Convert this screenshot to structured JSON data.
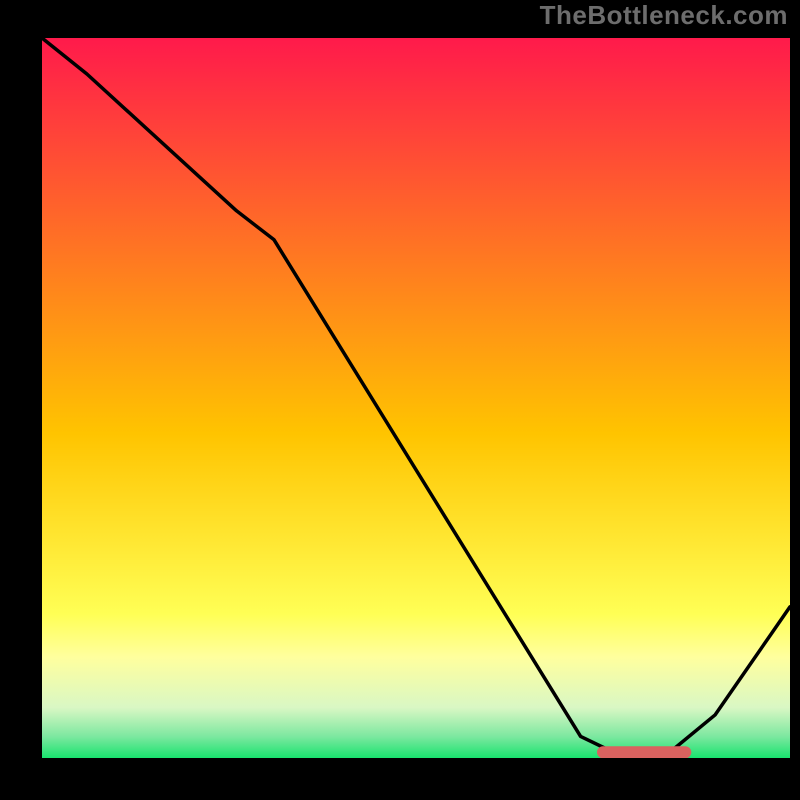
{
  "watermark": "TheBottleneck.com",
  "colors": {
    "gradient_top": "#ff1a4b",
    "gradient_mid": "#ffc400",
    "gradient_yellow_pale": "#ffff9e",
    "gradient_green_pale": "#baf7c4",
    "gradient_green": "#19e36e",
    "line": "#000000",
    "marker": "#d9625f",
    "marker_highlight": "#ef9a8e"
  },
  "chart_data": {
    "type": "line",
    "title": "",
    "xlabel": "",
    "ylabel": "",
    "xlim": [
      0,
      100
    ],
    "ylim": [
      0,
      100
    ],
    "grid": false,
    "legend": false,
    "series": [
      {
        "name": "bottleneck-curve",
        "x": [
          0,
          6,
          26,
          31,
          72,
          78,
          83,
          90,
          100
        ],
        "y": [
          100,
          95,
          76,
          72,
          3,
          0,
          0,
          6,
          21
        ]
      }
    ],
    "annotations": [
      {
        "name": "optimal-range-marker",
        "type": "segment",
        "x0": 75,
        "y0": 0.8,
        "x1": 86,
        "y1": 0.8
      }
    ],
    "background_bands_pct_from_top": [
      {
        "stop": 0,
        "color": "#ff1a4b"
      },
      {
        "stop": 55,
        "color": "#ffc400"
      },
      {
        "stop": 80,
        "color": "#ffff55"
      },
      {
        "stop": 86,
        "color": "#ffff9e"
      },
      {
        "stop": 93,
        "color": "#d9f7c4"
      },
      {
        "stop": 97,
        "color": "#7de8a0"
      },
      {
        "stop": 100,
        "color": "#19e36e"
      }
    ]
  }
}
